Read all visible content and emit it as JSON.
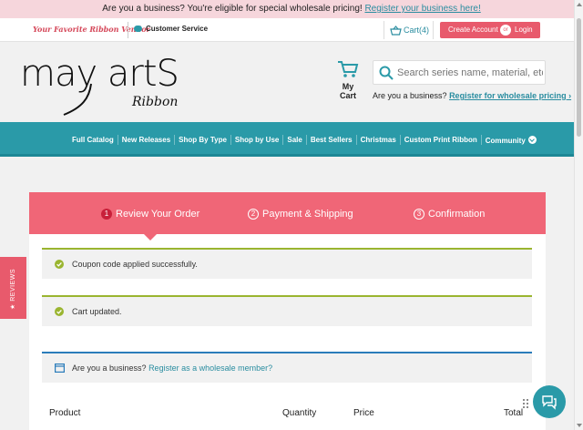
{
  "promo": {
    "text": "Are you a business? You're eligible for special wholesale pricing! ",
    "link": "Register your business here!"
  },
  "util": {
    "tagline": "Your Favorite Ribbon Vendor",
    "customer_service": "Customer Service",
    "cart": "Cart(4)",
    "create_account": "Create Account",
    "or": "or",
    "login": "Login"
  },
  "header": {
    "logo_main": "may artS",
    "logo_sub": "Ribbon",
    "my_cart": "My Cart",
    "search_placeholder": "Search series name, material, etc.",
    "biz_text": "Are you a business? ",
    "biz_link": "Register for wholesale pricing ›"
  },
  "nav": {
    "items": [
      "Full Catalog",
      "New Releases",
      "Shop By Type",
      "Shop by Use",
      "Sale",
      "Best Sellers",
      "Christmas",
      "Custom Print Ribbon",
      "Community"
    ]
  },
  "checkout": {
    "steps": [
      {
        "num": "1",
        "label": "Review Your Order"
      },
      {
        "num": "2",
        "label": "Payment & Shipping"
      },
      {
        "num": "3",
        "label": "Confirmation"
      }
    ],
    "messages": {
      "coupon": "Coupon code applied successfully.",
      "cart_updated": "Cart updated.",
      "business_q": "Are you a business? ",
      "business_link": "Register as a wholesale member?"
    },
    "columns": {
      "product": "Product",
      "quantity": "Quantity",
      "price": "Price",
      "total": "Total"
    }
  },
  "side": {
    "reviews": "★ REVIEWS"
  },
  "colors": {
    "teal": "#2a9aa8",
    "pink": "#f06677",
    "success": "#9ab530",
    "info": "#2a7cba"
  }
}
